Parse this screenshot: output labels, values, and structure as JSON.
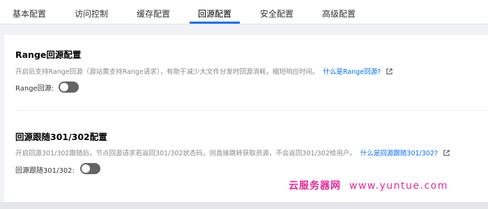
{
  "tabs": [
    {
      "label": "基本配置",
      "active": false
    },
    {
      "label": "访问控制",
      "active": false
    },
    {
      "label": "缓存配置",
      "active": false
    },
    {
      "label": "回源配置",
      "active": true
    },
    {
      "label": "安全配置",
      "active": false
    },
    {
      "label": "高级配置",
      "active": false
    }
  ],
  "range_section": {
    "title": "Range回源配置",
    "description": "开启后支持Range回源（源站需支持Range请求），有助于减少大文件分发时回源消耗，缩短响应时间。",
    "help_link": "什么是Range回源?",
    "field_label": "Range回源:",
    "toggle_on": false
  },
  "redirect_section": {
    "title": "回源跟随301/302配置",
    "description": "开启回源301/302跟随后，节点回源请求若返回301/302状态码，则直接跳转获取资源，不会返回301/302给用户。",
    "help_link": "什么是回源跟随301/302?",
    "field_label": "回源跟随301/302:",
    "toggle_on": false
  },
  "watermark": {
    "text": "云服务器网",
    "url": "www.yuntue.com"
  },
  "colors": {
    "accent": "#006eff",
    "toggle_off": "#646464",
    "watermark": "#e8259a"
  }
}
